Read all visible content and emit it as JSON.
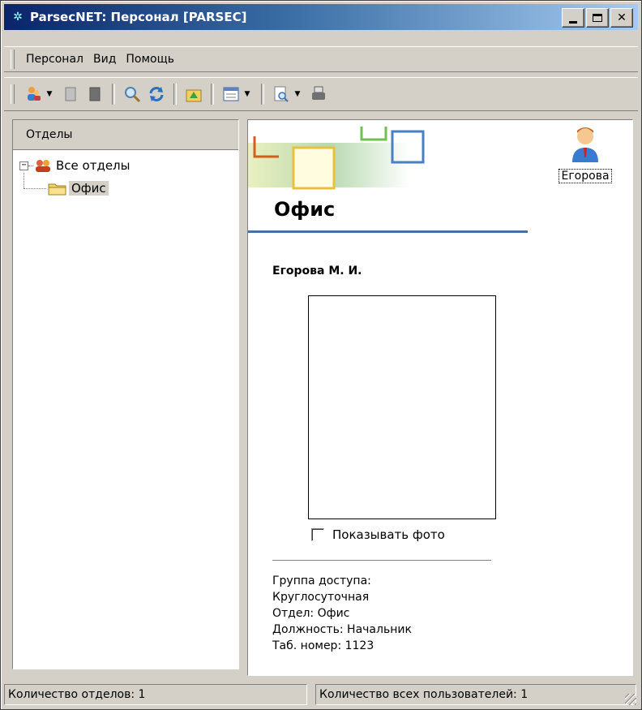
{
  "window": {
    "title": "ParsecNET: Персонал [PARSEC]",
    "controls": {
      "minimize": "_",
      "maximize": "□",
      "close": "✕"
    }
  },
  "menu": {
    "items": [
      "Персонал",
      "Вид",
      "Помощь"
    ]
  },
  "toolbar": {
    "icons": [
      "users-icon",
      "page-icon",
      "page-dark-icon",
      "search-icon",
      "refresh-icon",
      "home-icon",
      "list-view-icon",
      "preview-icon",
      "printer-icon"
    ]
  },
  "left_panel": {
    "header": "Отделы",
    "tree": {
      "root": {
        "label": "Все отделы",
        "expander": "−",
        "icon": "group-icon"
      },
      "child": {
        "label": "Офис",
        "icon": "folder-icon",
        "selected": true
      }
    }
  },
  "right_panel": {
    "department": "Офис",
    "user_caption": "Егорова",
    "person_name": "Егорова М. И.",
    "show_photo_label": "Показывать фото",
    "show_photo_checked": false,
    "details": {
      "access_group": "Группа доступа:",
      "access_group_value": "Круглосуточная",
      "department_line": "Отдел: Офис",
      "position_line": "Должность: Начальник",
      "tab_number_line": "Таб. номер: 1123"
    }
  },
  "status": {
    "departments": "Количество отделов: 1",
    "users": "Количество всех пользователей: 1"
  },
  "colors": {
    "titlebar_start": "#0a246a",
    "titlebar_end": "#a6caf0",
    "face": "#d4d0c8",
    "banner_line": "#4a6fa5"
  }
}
